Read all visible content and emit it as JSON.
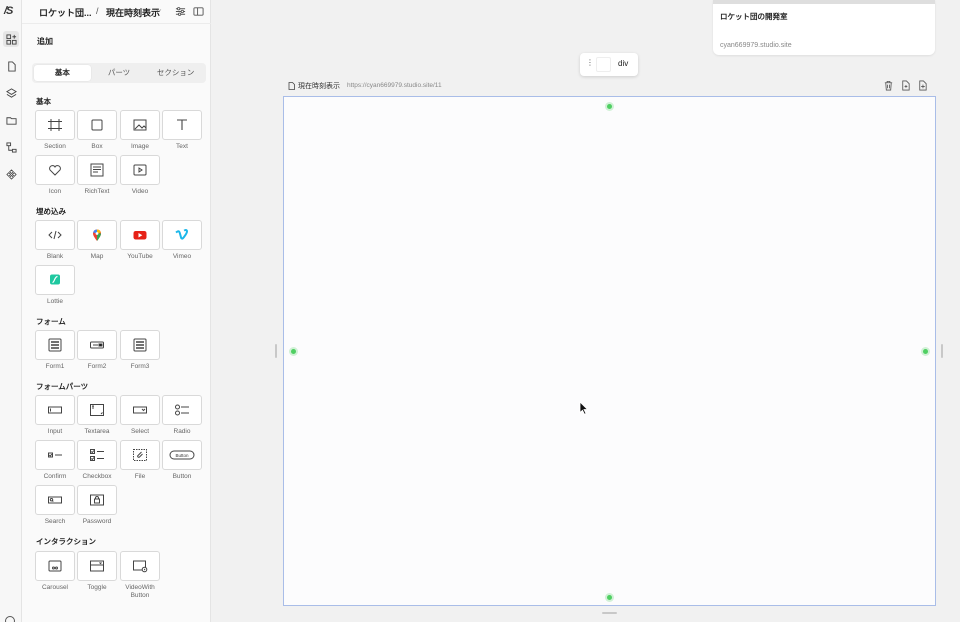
{
  "app": {
    "logo": "/S",
    "project_name": "ロケット団...",
    "breadcrumb_sep": "/",
    "page_name": "現在時刻表示"
  },
  "sidebar": {
    "title": "追加",
    "tabs": [
      {
        "label": "基本",
        "active": true
      },
      {
        "label": "パーツ",
        "active": false
      },
      {
        "label": "セクション",
        "active": false
      }
    ],
    "groups": [
      {
        "title": "基本",
        "items": [
          {
            "label": "Section",
            "icon": "frame-icon"
          },
          {
            "label": "Box",
            "icon": "square-icon"
          },
          {
            "label": "Image",
            "icon": "image-icon"
          },
          {
            "label": "Text",
            "icon": "text-icon"
          },
          {
            "label": "Icon",
            "icon": "heart-icon"
          },
          {
            "label": "RichText",
            "icon": "richtext-icon"
          },
          {
            "label": "Video",
            "icon": "video-icon"
          }
        ]
      },
      {
        "title": "埋め込み",
        "items": [
          {
            "label": "Blank",
            "icon": "code-icon"
          },
          {
            "label": "Map",
            "icon": "map-pin-icon"
          },
          {
            "label": "YouTube",
            "icon": "youtube-icon"
          },
          {
            "label": "Vimeo",
            "icon": "vimeo-icon"
          },
          {
            "label": "Lottie",
            "icon": "lottie-icon"
          }
        ]
      },
      {
        "title": "フォーム",
        "items": [
          {
            "label": "Form1",
            "icon": "form-icon"
          },
          {
            "label": "Form2",
            "icon": "form-inline-icon"
          },
          {
            "label": "Form3",
            "icon": "form-icon"
          }
        ]
      },
      {
        "title": "フォームパーツ",
        "items": [
          {
            "label": "Input",
            "icon": "input-icon"
          },
          {
            "label": "Textarea",
            "icon": "textarea-icon"
          },
          {
            "label": "Select",
            "icon": "select-icon"
          },
          {
            "label": "Radio",
            "icon": "radio-icon"
          },
          {
            "label": "Confirm",
            "icon": "confirm-icon"
          },
          {
            "label": "Checkbox",
            "icon": "checkbox-icon"
          },
          {
            "label": "File",
            "icon": "file-attach-icon"
          },
          {
            "label": "Button",
            "icon": "button-icon",
            "inner": "Button"
          },
          {
            "label": "Search",
            "icon": "search-field-icon"
          },
          {
            "label": "Password",
            "icon": "lock-icon"
          }
        ]
      },
      {
        "title": "インタラクション",
        "items": [
          {
            "label": "Carousel",
            "icon": "carousel-icon"
          },
          {
            "label": "Toggle",
            "icon": "toggle-icon"
          },
          {
            "label": "VideoWith Button",
            "icon": "video-button-icon"
          }
        ]
      }
    ]
  },
  "site_card": {
    "title": "ロケット団の開発室",
    "url": "cyan669979.studio.site"
  },
  "selection_chip": {
    "tag": "div"
  },
  "frame": {
    "label": "現在時刻表示",
    "url": "https://cyan669979.studio.site/11"
  },
  "colors": {
    "handle": "#4fcf62",
    "frame_border": "#a9bde8",
    "youtube": "#e62117",
    "vimeo": "#1ab7ea",
    "lottie": "#1fc8a0"
  }
}
